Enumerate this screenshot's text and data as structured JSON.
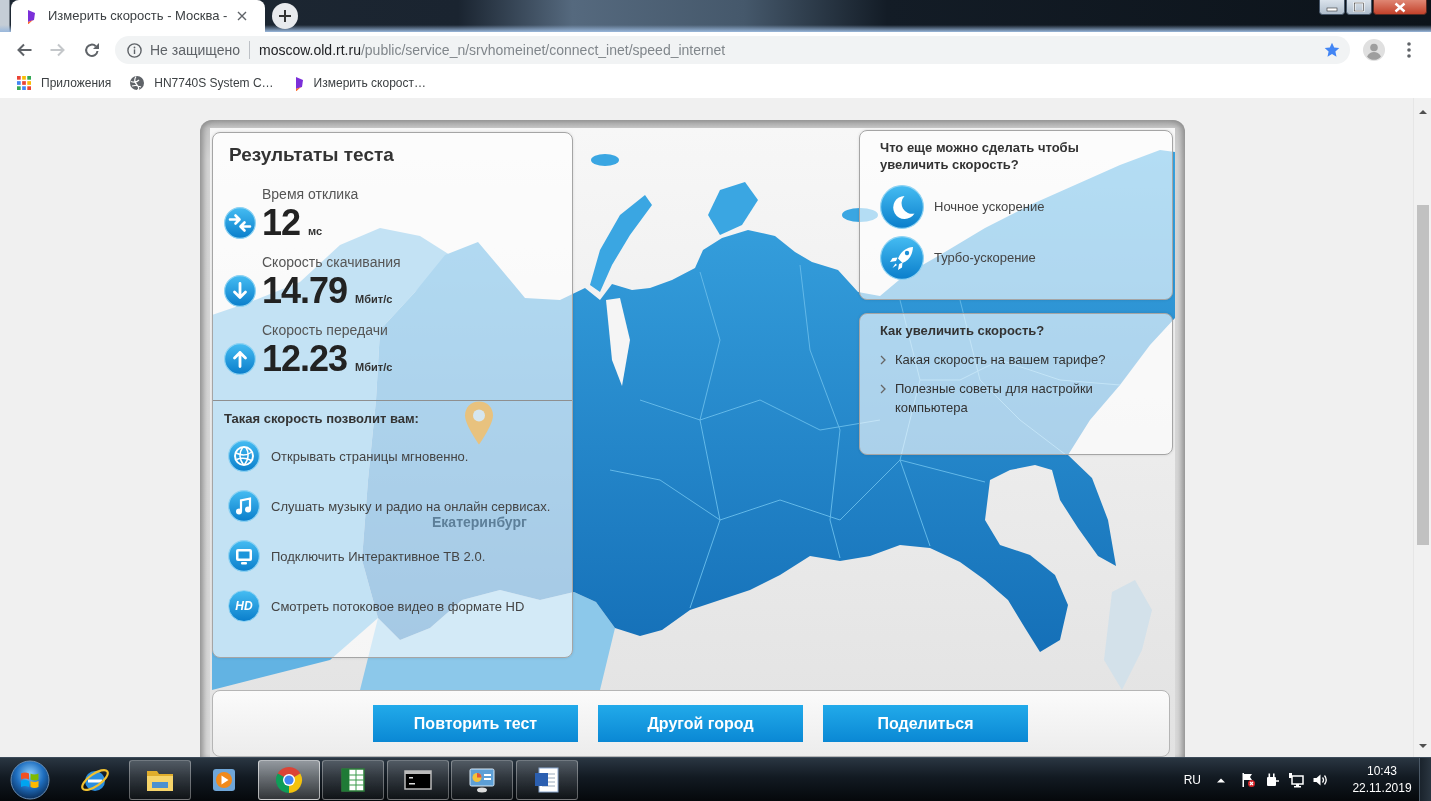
{
  "browser": {
    "tabs": [
      {
        "title": "Измерить скорость - Москва -",
        "selected": true
      }
    ],
    "nav_buttons": [
      {
        "kind": "back",
        "disabled": false
      },
      {
        "kind": "forward",
        "disabled": true
      },
      {
        "kind": "reload",
        "disabled": false
      }
    ],
    "address_bar": {
      "security": "Не защищено",
      "url_host": "moscow.old.rt.ru",
      "url_path": "/public/service_n/srvhomeinet/connect_inet/speed_internet",
      "bookmarked": true
    },
    "bookmarks": [
      {
        "kind": "apps",
        "label": "Приложения"
      },
      {
        "kind": "globe",
        "label": "HN7740S System C…"
      },
      {
        "kind": "logo",
        "label": "Измерить скорост…"
      }
    ]
  },
  "speed_test": {
    "results": {
      "title": "Результаты теста",
      "metrics": [
        {
          "kind": "ping",
          "label": "Время отклика",
          "value": "12",
          "unit": "мс"
        },
        {
          "kind": "download",
          "label": "Скорость скачивания",
          "value": "14.79",
          "unit": "Мбит/с"
        },
        {
          "kind": "upload",
          "label": "Скорость передачи",
          "value": "12.23",
          "unit": "Мбит/с"
        }
      ],
      "benefits_title": "Такая скорость позволит вам:",
      "benefits": [
        {
          "kind": "globe",
          "text": "Открывать страницы мгновенно."
        },
        {
          "kind": "music",
          "text": "Слушать музыку и радио на онлайн сервисах."
        },
        {
          "kind": "tv",
          "text": "Подключить Интерактивное ТВ 2.0."
        },
        {
          "kind": "hd",
          "badge": "HD",
          "text": "Смотреть потоковое видео в формате HD"
        }
      ]
    },
    "map": {
      "city": "Екатеринбург"
    },
    "boost": {
      "title": "Что еще можно сделать чтобы увеличить скорость?",
      "options": [
        {
          "kind": "moon",
          "label": "Ночное ускорение"
        },
        {
          "kind": "rocket",
          "label": "Турбо-ускорение"
        }
      ]
    },
    "tips": {
      "title": "Как увеличить скорость?",
      "links": [
        "Какая скорость на вашем тарифе?",
        "Полезные советы для настройки компьютера"
      ]
    },
    "buttons": [
      "Повторить тест",
      "Другой город",
      "Поделиться"
    ]
  },
  "taskbar": {
    "apps": [
      {
        "kind": "ie",
        "running": false,
        "active": false
      },
      {
        "kind": "explorer",
        "running": true,
        "active": false
      },
      {
        "kind": "media",
        "running": false,
        "active": false
      },
      {
        "kind": "chrome",
        "running": true,
        "active": true
      },
      {
        "kind": "excel",
        "running": true,
        "active": false
      },
      {
        "kind": "cmd",
        "running": true,
        "active": false
      },
      {
        "kind": "control",
        "running": true,
        "active": false
      },
      {
        "kind": "word",
        "running": true,
        "active": false
      }
    ],
    "language": "RU",
    "time": "10:43",
    "date": "22.11.2019"
  }
}
